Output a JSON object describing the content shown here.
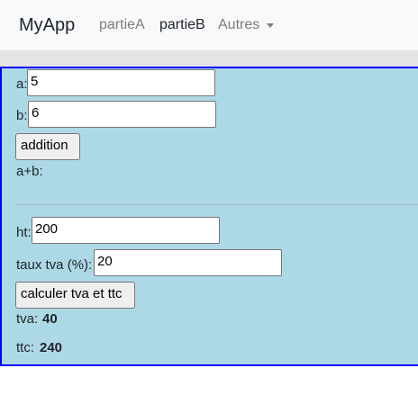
{
  "navbar": {
    "brand": "MyApp",
    "links": [
      {
        "label": "partieA"
      },
      {
        "label": "partieB"
      },
      {
        "label": "Autres"
      }
    ]
  },
  "addition": {
    "a_label": "a:",
    "a_value": "5",
    "b_label": "b:",
    "b_value": "6",
    "button_label": "addition",
    "result_label": "a+b:",
    "result_value": ""
  },
  "tva": {
    "ht_label": "ht:",
    "ht_value": "200",
    "taux_label": "taux tva (%):",
    "taux_value": "20",
    "button_label": "calculer tva et ttc",
    "tva_label": "tva:",
    "tva_value": "40",
    "ttc_label": "ttc:",
    "ttc_value": "240"
  },
  "colors": {
    "panel_bg": "#add8e6",
    "panel_border": "#0000ff",
    "navbar_bg": "#f8f9fa"
  }
}
